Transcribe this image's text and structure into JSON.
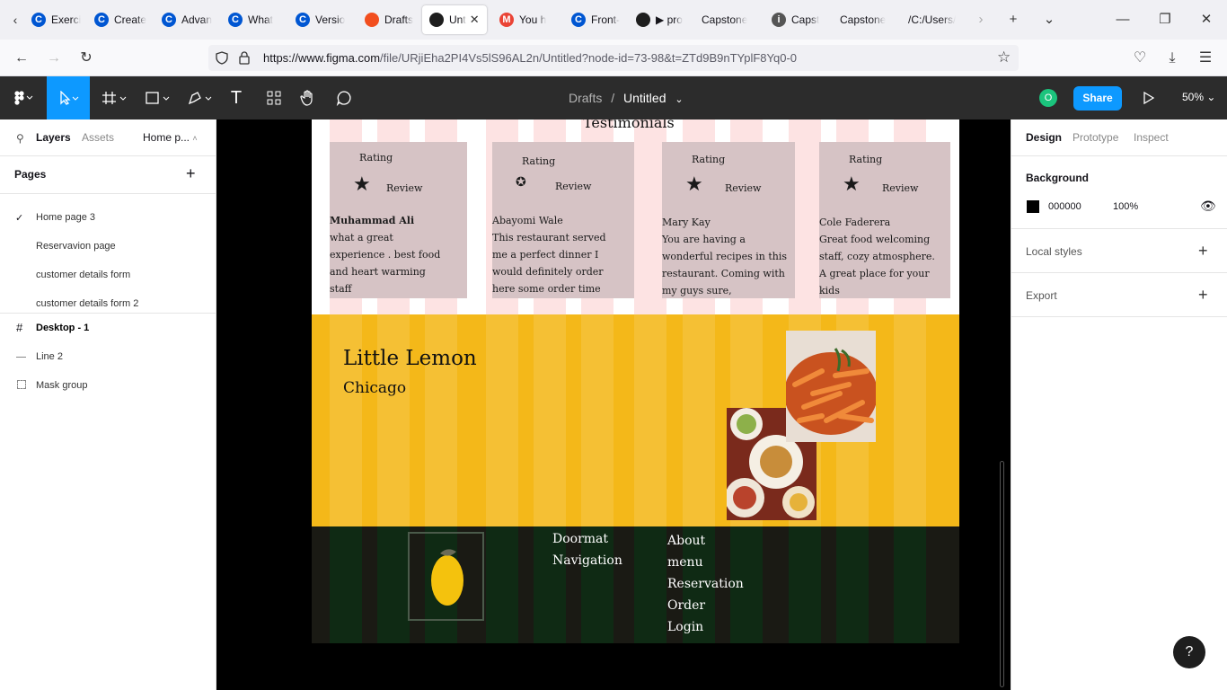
{
  "browser": {
    "tabs": [
      {
        "label": "Exerci",
        "icon": "coursera-icon",
        "color": "#0056d2"
      },
      {
        "label": "Create",
        "icon": "coursera-icon",
        "color": "#0056d2"
      },
      {
        "label": "Advan",
        "icon": "coursera-icon",
        "color": "#0056d2"
      },
      {
        "label": "What",
        "icon": "coursera-icon",
        "color": "#0056d2"
      },
      {
        "label": "Versio",
        "icon": "coursera-icon",
        "color": "#0056d2"
      },
      {
        "label": "Drafts",
        "icon": "figma-icon",
        "color": "#f24e1e"
      },
      {
        "label": "Unt",
        "icon": "figma-icon",
        "color": "#1e1e1e"
      },
      {
        "label": "You h",
        "icon": "gmail-icon",
        "color": "#ea4335"
      },
      {
        "label": "Front-",
        "icon": "coursera-icon",
        "color": "#0056d2"
      },
      {
        "label": "▶ pro",
        "icon": "figma-icon",
        "color": "#1e1e1e"
      },
      {
        "label": "Capstone",
        "icon": "",
        "color": ""
      },
      {
        "label": "Capst",
        "icon": "info-icon",
        "color": "#555555"
      },
      {
        "label": "Capstone",
        "icon": "",
        "color": ""
      },
      {
        "label": "/C:/Users/",
        "icon": "",
        "color": ""
      }
    ],
    "url_host": "https://www.figma.com",
    "url_path": "/file/URjiEha2PI4Vs5lS96AL2n/Untitled?node-id=73-98&t=ZTd9B9nTYplF8Yq0-0"
  },
  "figma": {
    "breadcrumb_team": "Drafts",
    "breadcrumb_sep": "/",
    "file_name": "Untitled",
    "avatar_letter": "O",
    "share_label": "Share",
    "zoom": "50%",
    "accent": "#0d99ff"
  },
  "left_panel": {
    "tab_layers": "Layers",
    "tab_assets": "Assets",
    "page_selector": "Home p...",
    "pages_heading": "Pages",
    "pages": [
      "Home page 3",
      "Reservavion page",
      "customer details form",
      "customer details form 2"
    ],
    "layers": [
      "Desktop - 1",
      "Line 2",
      "Mask group"
    ]
  },
  "right_panel": {
    "tabs": [
      "Design",
      "Prototype",
      "Inspect"
    ],
    "background_label": "Background",
    "bg_hex": "000000",
    "bg_opacity": "100%",
    "local_styles": "Local styles",
    "export": "Export"
  },
  "design": {
    "section_title": "Testimonials",
    "cards": [
      {
        "rating": "Rating",
        "review": "Review",
        "name": "Muhammad  Ali",
        "text": "what a great experience . best food and  heart warming staff"
      },
      {
        "rating": "Rating",
        "review": "Review",
        "name": "Abayomi  Wale",
        "text": "This restaurant served me a perfect dinner I would definitely order here some order time"
      },
      {
        "rating": "Rating",
        "review": "Review",
        "name": "Mary Kay",
        "text": "You are having a wonderful recipes in this restaurant. Coming with my guys sure,"
      },
      {
        "rating": "Rating",
        "review": "Review",
        "name": "Cole Faderera",
        "text": "Great food welcoming staff, cozy atmosphere. A great place for your kids"
      }
    ],
    "brand": "Little Lemon",
    "city": "Chicago",
    "doormat": [
      "Doormat",
      "Navigation"
    ],
    "nav_links": [
      "About",
      "menu",
      "Reservation",
      "Order",
      "Login"
    ]
  }
}
